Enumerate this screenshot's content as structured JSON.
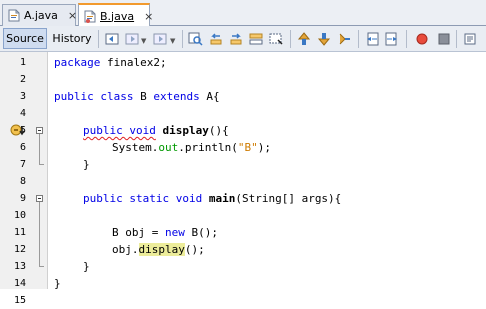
{
  "tabs": [
    {
      "label": "A.java",
      "close": "×",
      "active": false
    },
    {
      "label": "B.java",
      "close": "×",
      "active": true
    }
  ],
  "toolbar": {
    "source_label": "Source",
    "history_label": "History"
  },
  "editor": {
    "line_numbers": [
      "1",
      "2",
      "3",
      "4",
      "5",
      "6",
      "7",
      "8",
      "9",
      "10",
      "11",
      "12",
      "13",
      "14",
      "15"
    ],
    "lines": [
      "package finalex2;",
      "",
      "public class B extends A{",
      "",
      "public void display(){",
      "System.out.println(\"B\");",
      "}",
      "",
      "public static void main(String[] args){",
      "",
      "B obj = new B();",
      "obj.display();",
      "}",
      "}",
      ""
    ]
  },
  "colors": {
    "keyword": "#0000e6",
    "string": "#ce7b00",
    "field": "#009900",
    "highlight": "#ecec9a",
    "tab_active_accent": "#f29a2e"
  },
  "icons": [
    "java-file-icon",
    "back-icon",
    "forward-icon",
    "find-icon",
    "find-prev-icon",
    "find-next-icon",
    "toggle-highlight-icon",
    "toggle-rect-select-icon",
    "prev-bookmark-icon",
    "next-bookmark-icon",
    "toggle-bookmark-icon",
    "shift-left-icon",
    "shift-right-icon",
    "start-macro-icon",
    "stop-macro-icon",
    "override-icon"
  ]
}
